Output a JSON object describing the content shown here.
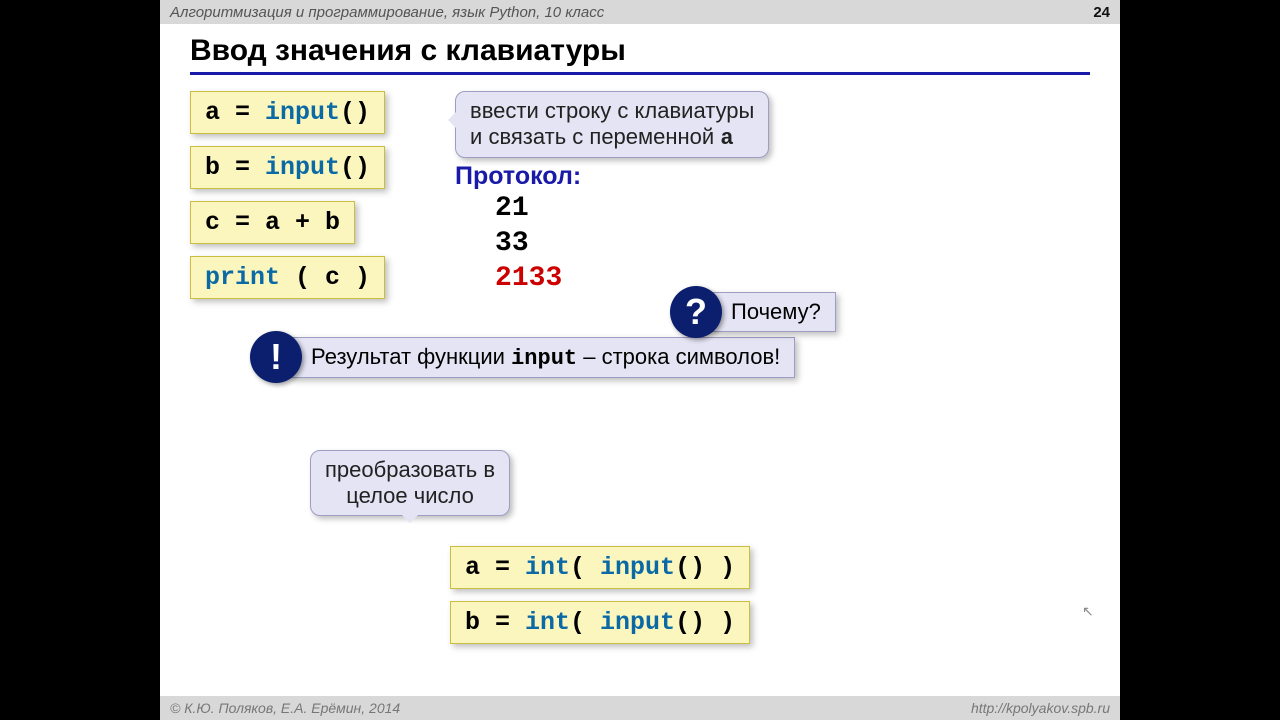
{
  "topbar": {
    "course": "Алгоритмизация и программирование, язык Python, 10 класс",
    "slide_num": "24"
  },
  "title": "Ввод значения с клавиатуры",
  "code": {
    "l1a": "a = ",
    "l1b": "input",
    "l1c": "()",
    "l2a": "b = ",
    "l2b": "input",
    "l2c": "()",
    "l3": "c = a + b",
    "l4a": "print",
    "l4b": " ( c )",
    "l5a": "a = ",
    "l5b": "int",
    "l5c": "( ",
    "l5d": "input",
    "l5e": "() )",
    "l6a": "b = ",
    "l6b": "int",
    "l6c": "( ",
    "l6d": "input",
    "l6e": "() )"
  },
  "hint1_l1": "ввести строку с клавиатуры",
  "hint1_l2a": "и связать с переменной ",
  "hint1_l2b": "a",
  "protocol_label": "Протокол:",
  "protocol": {
    "v1": "21",
    "v2": "33",
    "v3": "2133"
  },
  "why_icon": "?",
  "why_text": "Почему?",
  "bang_icon": "!",
  "result_a": "Результат функции ",
  "result_b": "input",
  "result_c": " – строка символов!",
  "convert_l1": "преобразовать в",
  "convert_l2": "целое число",
  "footer": {
    "left": "© К.Ю. Поляков, Е.А. Ерёмин, 2014",
    "right": "http://kpolyakov.spb.ru"
  }
}
